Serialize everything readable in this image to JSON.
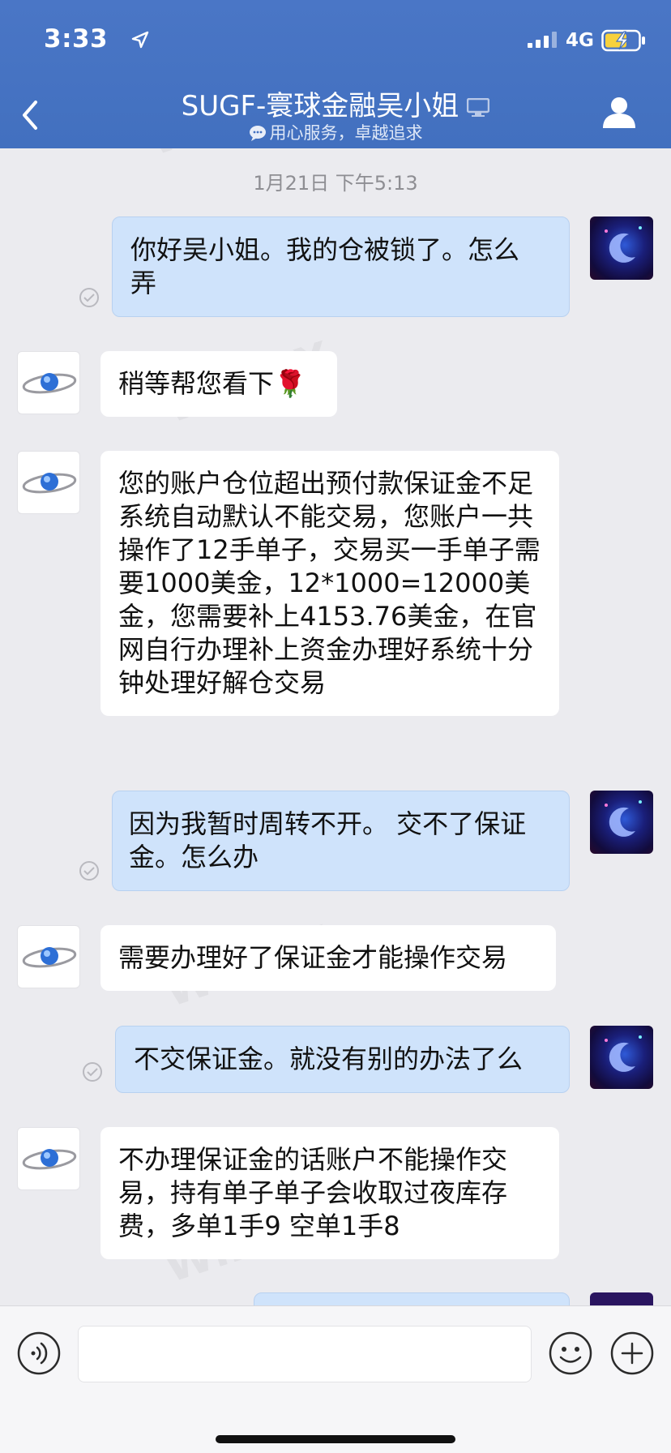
{
  "status_bar": {
    "time": "3:33",
    "network": "4G"
  },
  "header": {
    "contact_name": "SUGF-寰球金融吴小姐",
    "signature": "用心服务，卓越追求"
  },
  "chat": {
    "timestamp": "1月21日 下午5:13",
    "messages": [
      {
        "from": "me",
        "text": "你好吴小姐。我的仓被锁了。怎么弄"
      },
      {
        "from": "agent",
        "text": "稍等帮您看下🌹"
      },
      {
        "from": "agent",
        "text": "您的账户仓位超出预付款保证金不足系统自动默认不能交易，您账户一共操作了12手单子，交易买一手单子需要1000美金，12*1000=12000美金，您需要补上4153.76美金，在官网自行办理补上资金办理好系统十分钟处理好解仓交易"
      },
      {
        "from": "me",
        "text": "因为我暂时周转不开。 交不了保证金。怎么办"
      },
      {
        "from": "agent",
        "text": "需要办理好了保证金才能操作交易"
      },
      {
        "from": "me",
        "text": "不交保证金。就没有别的办法了么"
      },
      {
        "from": "agent",
        "text": "不办理保证金的话账户不能操作交易，持有单子单子会收取过夜库存费，多单1手9 空单1手8"
      }
    ]
  },
  "input_bar": {
    "value": "",
    "placeholder": ""
  },
  "watermark": "WikiFX",
  "colors": {
    "header": "#4270bf",
    "outgoing_bubble": "#cfe3fb",
    "incoming_bubble": "#ffffff",
    "background": "#ebebef"
  }
}
